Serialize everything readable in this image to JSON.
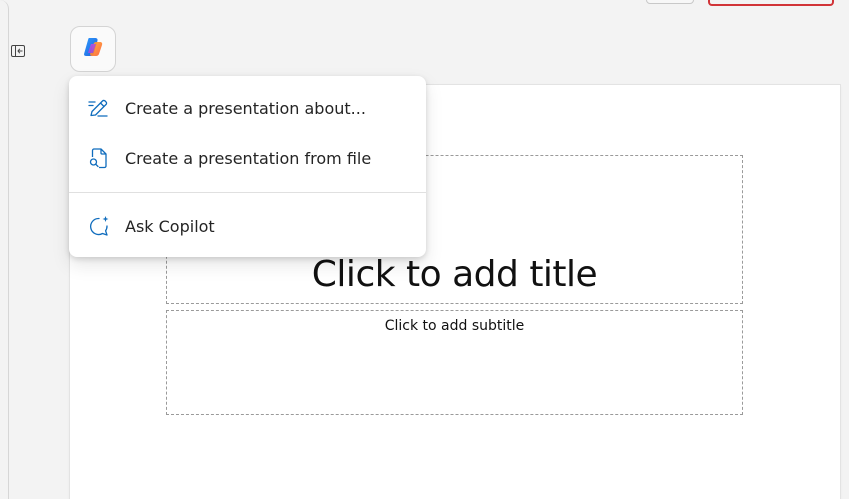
{
  "colors": {
    "accent": "#0f6cbd",
    "danger": "#d13438"
  },
  "menu": {
    "items": [
      {
        "label": "Create a presentation about...",
        "icon": "pen-sparkle-icon"
      },
      {
        "label": "Create a presentation from file",
        "icon": "document-search-icon"
      },
      {
        "label": "Ask Copilot",
        "icon": "chat-sparkle-icon"
      }
    ]
  },
  "slide": {
    "title_placeholder": "Click to add title",
    "subtitle_placeholder": "Click to add subtitle"
  },
  "icons": {
    "collapse": "collapse-pane-icon",
    "copilot": "copilot-icon"
  }
}
